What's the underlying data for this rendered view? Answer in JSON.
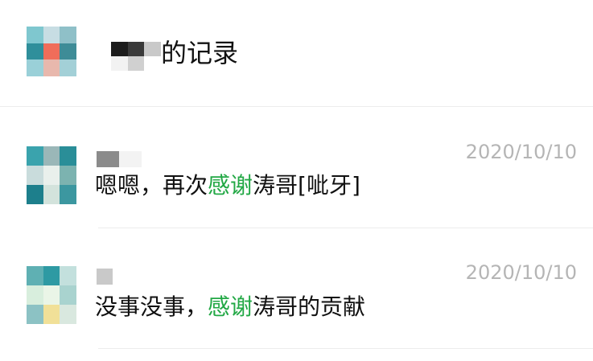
{
  "header": {
    "title": "的记录",
    "avatar_colors": [
      "#7fc7cf",
      "#c7dde3",
      "#8fc0c8",
      "#2f8f9b",
      "#f06d5a",
      "#3e8c97",
      "#9ad0d8",
      "#e8b8ad",
      "#a3d0d7"
    ],
    "name_blur_colors": [
      "#1c1c1c",
      "#3a3a3a",
      "#c9c9c9",
      "#f2f2f2",
      "#d0d0d0",
      "#ffffff"
    ]
  },
  "messages": [
    {
      "date": "2020/10/10",
      "parts": {
        "before": "嗯嗯，再次",
        "highlight": "感谢",
        "after": "涛哥[呲牙]"
      },
      "avatar_colors": [
        "#3aa3ad",
        "#9ab7b8",
        "#2a8e98",
        "#c9dcdc",
        "#e9f0ec",
        "#7cb3b0",
        "#1d7f8c",
        "#d3e3dc",
        "#3c97a0"
      ],
      "sender_colors": [
        "#8b8b8b",
        "#f3f3f3"
      ]
    },
    {
      "date": "2020/10/10",
      "parts": {
        "before": "没事没事，",
        "highlight": "感谢",
        "after": "涛哥的贡献"
      },
      "avatar_colors": [
        "#5fb0b3",
        "#2e9aa3",
        "#c3e0dd",
        "#d8eedd",
        "#eaf5e7",
        "#a9d3cf",
        "#8cc2c4",
        "#f1e098",
        "#d9e8df"
      ],
      "sender_colors": [
        "#c9c9c9",
        "#ffffff"
      ]
    }
  ],
  "colors": {
    "accent": "#22a845",
    "date": "#b5b5b5",
    "text": "#111111"
  }
}
